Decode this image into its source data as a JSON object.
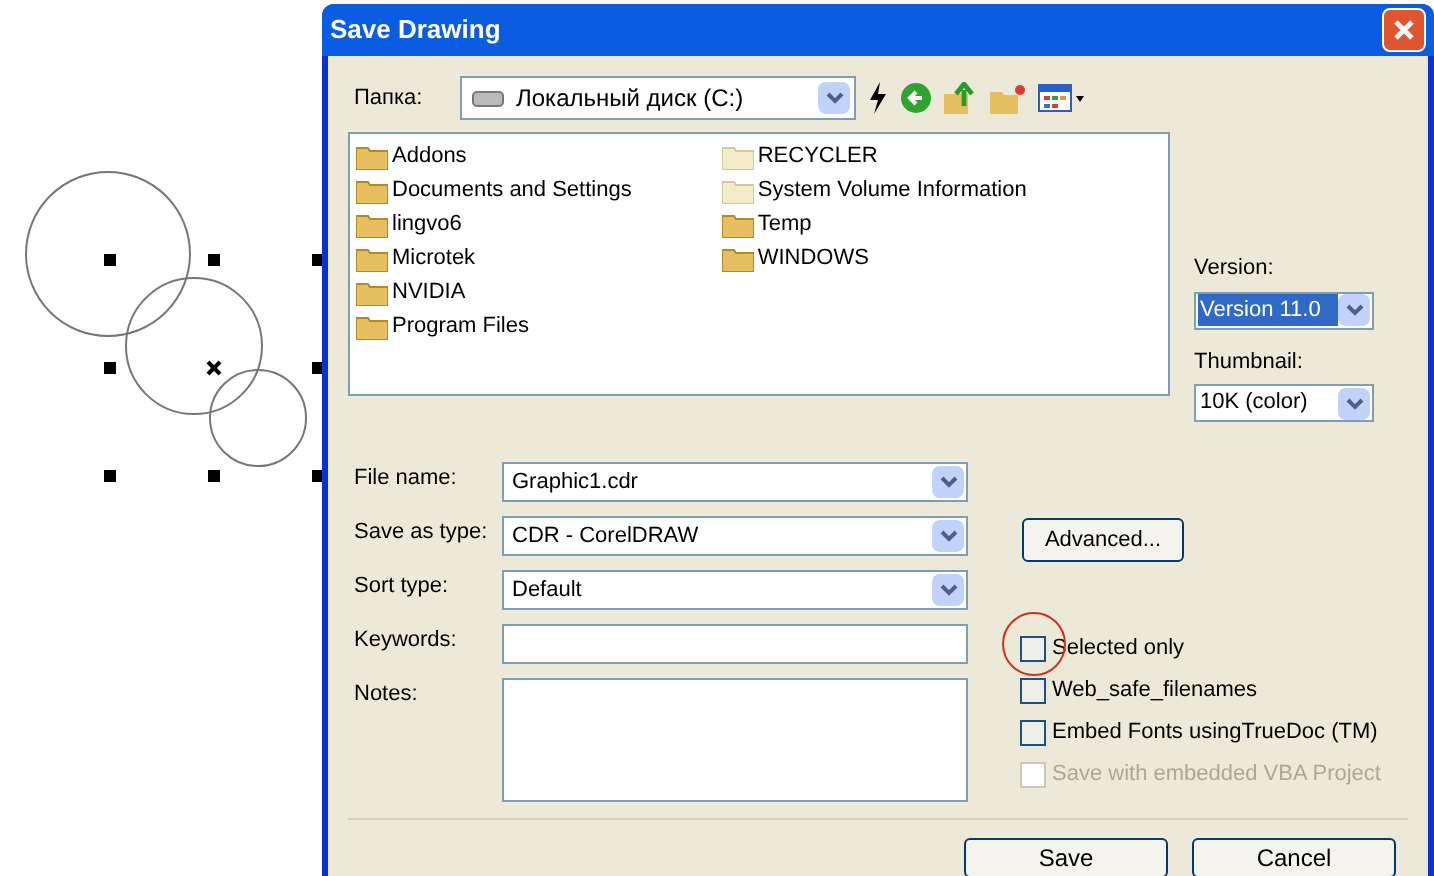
{
  "window": {
    "title": "Save Drawing"
  },
  "folder": {
    "label": "Папка:",
    "value": "Локальный диск (C:)"
  },
  "files": [
    {
      "name": "Addons",
      "hidden": false
    },
    {
      "name": "Documents and Settings",
      "hidden": false
    },
    {
      "name": "lingvo6",
      "hidden": false
    },
    {
      "name": "Microtek",
      "hidden": false
    },
    {
      "name": "NVIDIA",
      "hidden": false
    },
    {
      "name": "Program Files",
      "hidden": false
    },
    {
      "name": "RECYCLER",
      "hidden": true
    },
    {
      "name": "System Volume Information",
      "hidden": true
    },
    {
      "name": "Temp",
      "hidden": false
    },
    {
      "name": "WINDOWS",
      "hidden": false
    }
  ],
  "version": {
    "label": "Version:",
    "value": "Version 11.0",
    "selected": true
  },
  "thumbnail": {
    "label": "Thumbnail:",
    "value": "10K (color)",
    "selected": false
  },
  "fields": [
    {
      "label": "File name:",
      "value": "Graphic1.cdr",
      "kind": "combo"
    },
    {
      "label": "Save as type:",
      "value": "CDR - CorelDRAW",
      "kind": "combo"
    },
    {
      "label": "Sort type:",
      "value": "Default",
      "kind": "combo"
    },
    {
      "label": "Keywords:",
      "kind": "text"
    },
    {
      "label": "Notes:",
      "kind": "area"
    }
  ],
  "advanced_button": "Advanced...",
  "options": [
    {
      "label": "Selected only",
      "checked": false,
      "disabled": false,
      "circled": true
    },
    {
      "label": "Web_safe_filenames",
      "checked": false,
      "disabled": false,
      "circled": false
    },
    {
      "label": "Embed Fonts usingTrueDoc (TM)",
      "checked": false,
      "disabled": false,
      "circled": false
    },
    {
      "label": "Save with embedded VBA Project",
      "checked": false,
      "disabled": true,
      "circled": false
    }
  ],
  "buttons": [
    "Save",
    "Cancel"
  ]
}
